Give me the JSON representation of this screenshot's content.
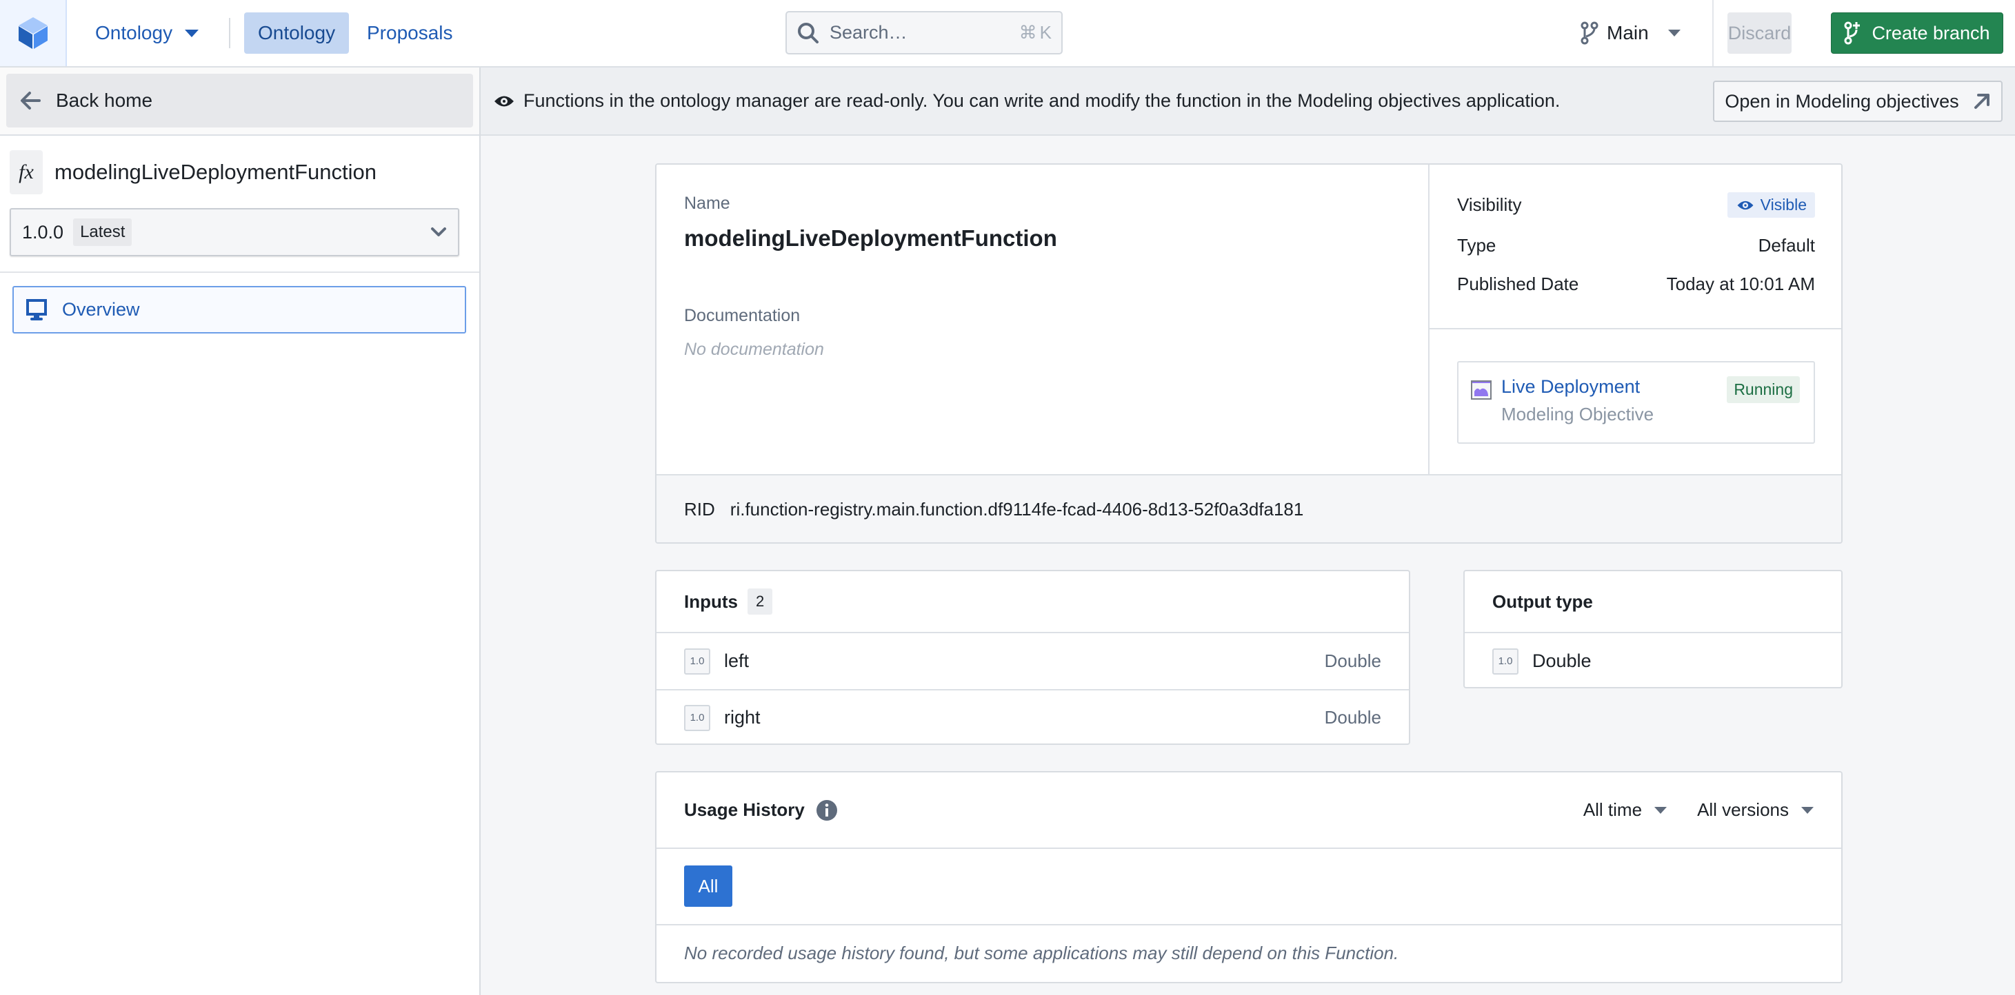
{
  "header": {
    "app_menu_label": "Ontology",
    "tabs": [
      {
        "label": "Ontology",
        "active": true
      },
      {
        "label": "Proposals",
        "active": false
      }
    ],
    "search": {
      "placeholder": "Search…",
      "shortcut_symbol": "⌘",
      "shortcut_key": "K"
    },
    "branch_label": "Main",
    "discard_label": "Discard",
    "create_branch_label": "Create branch"
  },
  "sidebar": {
    "back_label": "Back home",
    "function_icon": "fx",
    "function_name": "modelingLiveDeploymentFunction",
    "version": "1.0.0",
    "version_tag": "Latest",
    "nav_items": [
      {
        "label": "Overview",
        "icon": "desktop-icon",
        "selected": true
      }
    ]
  },
  "banner": {
    "message": "Functions in the ontology manager are read-only. You can write and modify the function in the Modeling objectives application.",
    "open_button_label": "Open in Modeling objectives"
  },
  "details": {
    "name_label": "Name",
    "name_value": "modelingLiveDeploymentFunction",
    "documentation_label": "Documentation",
    "documentation_value": "No documentation",
    "properties": [
      {
        "label": "Visibility",
        "value": "Visible"
      },
      {
        "label": "Type",
        "value": "Default"
      },
      {
        "label": "Published Date",
        "value": "Today at 10:01 AM"
      }
    ],
    "deployment": {
      "title": "Live Deployment",
      "subtitle": "Modeling Objective",
      "status": "Running"
    },
    "rid_label": "RID",
    "rid_value": "ri.function-registry.main.function.df9114fe-fcad-4406-8d13-52f0a3dfa181"
  },
  "inputs": {
    "title": "Inputs",
    "count": "2",
    "items": [
      {
        "icon_text": "1.0",
        "name": "left",
        "type": "Double"
      },
      {
        "icon_text": "1.0",
        "name": "right",
        "type": "Double"
      }
    ]
  },
  "output": {
    "title": "Output type",
    "icon_text": "1.0",
    "type": "Double"
  },
  "usage": {
    "title": "Usage History",
    "time_filter": "All time",
    "version_filter": "All versions",
    "all_button_label": "All",
    "empty_message": "No recorded usage history found, but some applications may still depend on this Function."
  },
  "colors": {
    "accent": "#2d72d2",
    "link": "#1f5bb4",
    "success": "#238551",
    "running_text": "#1c6e43"
  }
}
